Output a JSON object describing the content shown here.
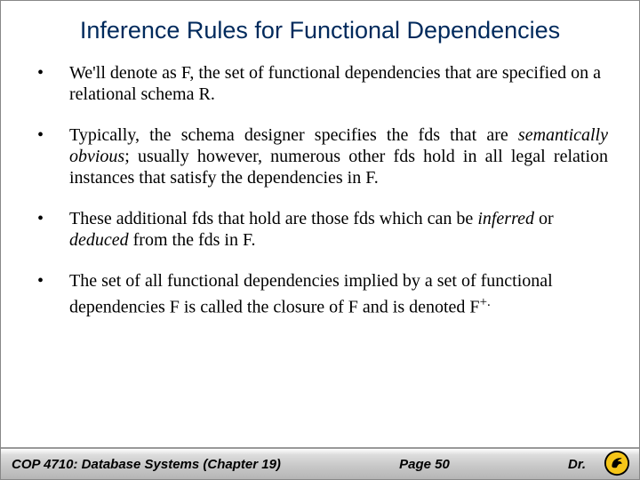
{
  "title": "Inference Rules for Functional Dependencies",
  "bullets": {
    "b1": "We'll denote as F, the set of functional dependencies that are specified on a relational schema R.",
    "b2_a": "Typically, the schema designer specifies the fds that are ",
    "b2_b": "semantically obvious",
    "b2_c": "; usually however, numerous other fds hold in all legal relation instances that satisfy the dependencies in F.",
    "b3_a": "These additional fds that hold are those fds which can be ",
    "b3_b": "inferred",
    "b3_c": " or ",
    "b3_d": "deduced",
    "b3_e": " from the fds in F.",
    "b4_a": "The set of all functional dependencies implied by a set of functional dependencies F is called the closure of F and is denoted F",
    "b4_b": "+."
  },
  "footer": {
    "left": "COP 4710: Database Systems  (Chapter 19)",
    "center": "Page 50",
    "right": "Dr."
  }
}
